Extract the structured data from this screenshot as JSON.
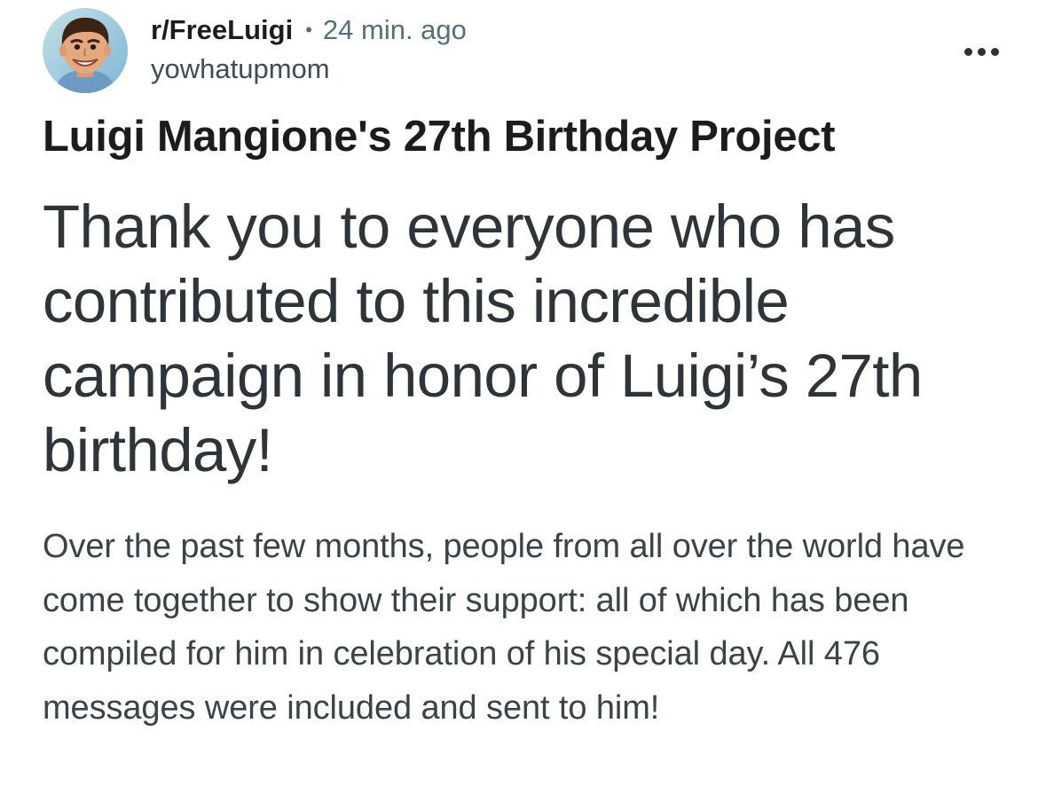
{
  "post": {
    "subreddit": "r/FreeLuigi",
    "separator": "•",
    "time_ago": "24 min. ago",
    "username": "yowhatupmom",
    "avatar": "avatar-cartoon-smiling-man",
    "more_icon": "ellipsis-icon",
    "title": "Luigi Mangione's 27th Birthday Project",
    "heading": "Thank you to everyone who has contributed to this incredible campaign in honor of Luigi’s 27th birthday!",
    "body": "Over the past few months, people from all over the world have come together to show their support: all of which has been compiled for him in celebration of his special day. All 476 messages were included and sent to him!"
  },
  "colors": {
    "background": "#ffffff",
    "title_text": "#1c1c1c",
    "meta_text": "#576f76",
    "heading_text": "#2e3438",
    "body_text": "#3c4346"
  }
}
